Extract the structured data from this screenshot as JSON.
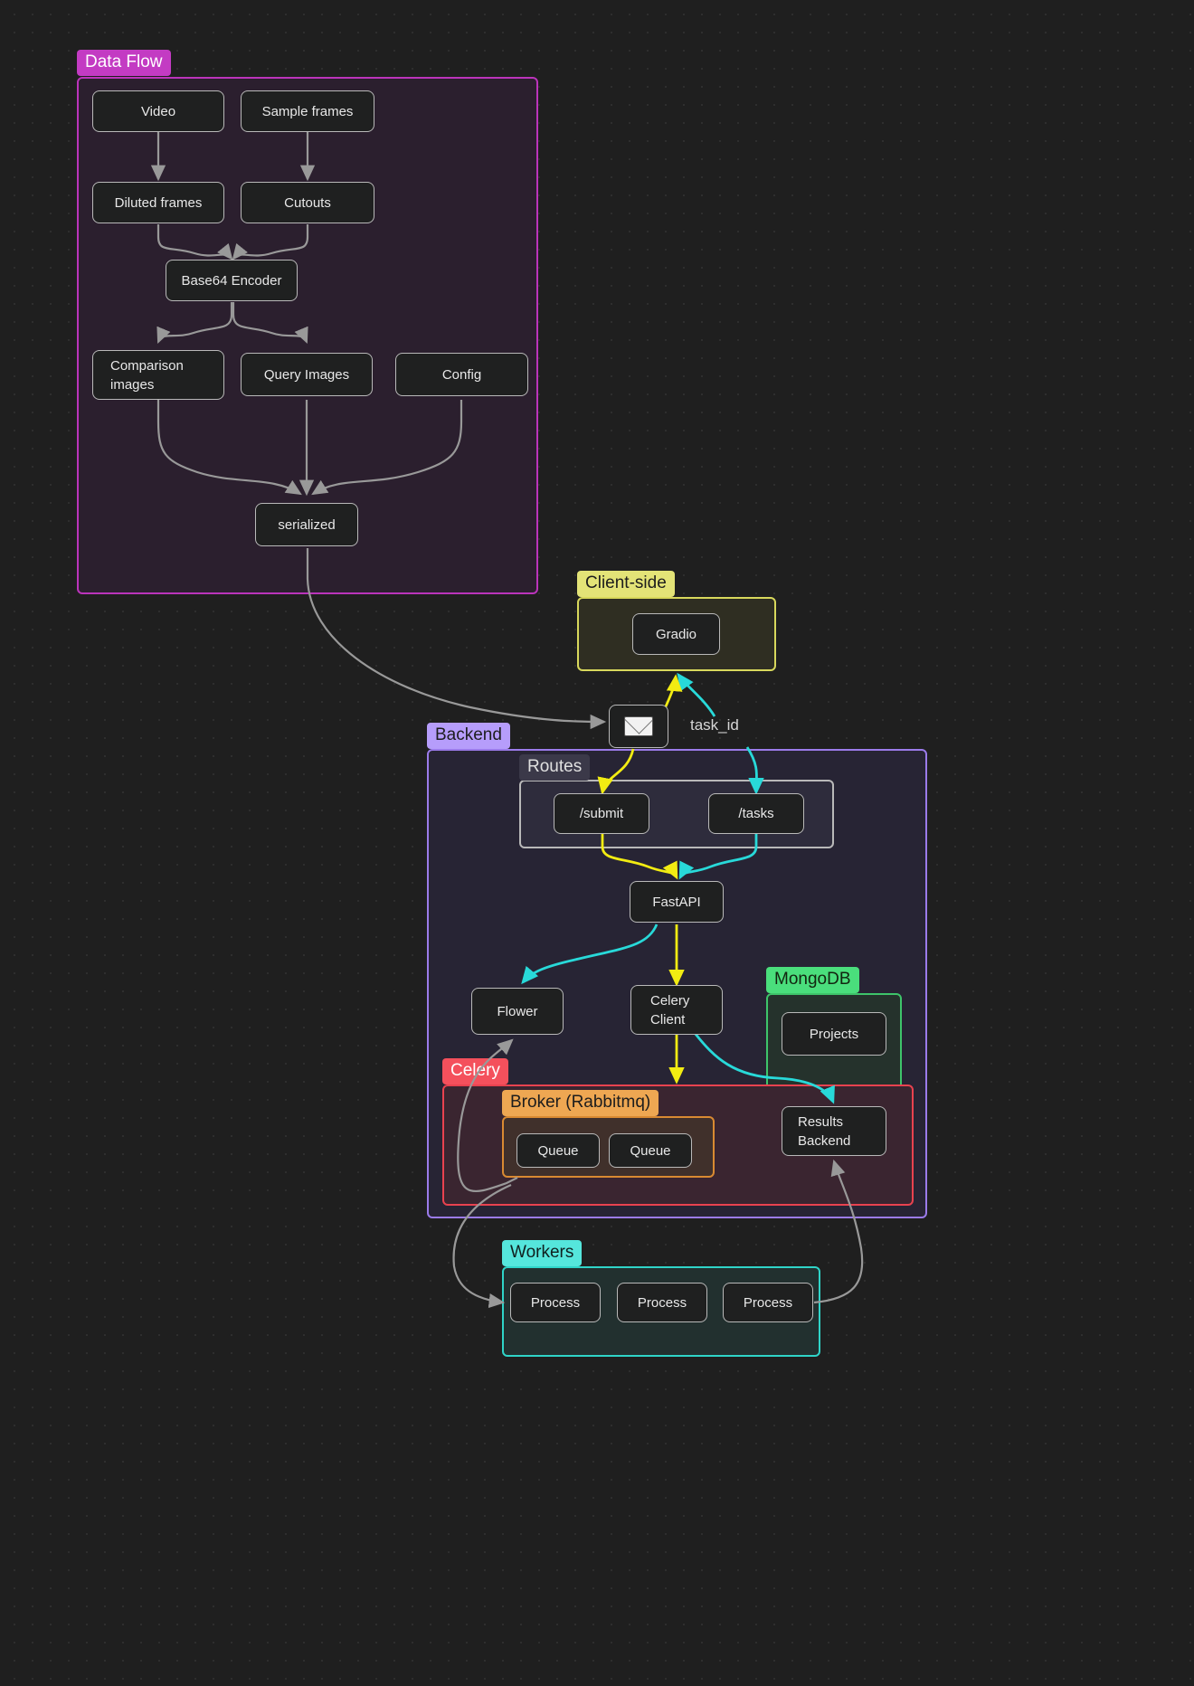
{
  "diagram": {
    "title": "Data Flow / Backend architecture diagram",
    "background": "#1f1f1f"
  },
  "clusters": [
    {
      "id": "data-flow",
      "label": "Data Flow",
      "border_color": "#bb34bb",
      "fill_color": "#2b1f2e",
      "label_bg": "#c33bc3",
      "label_color": "#ffffff"
    },
    {
      "id": "client-side",
      "label": "Client-side",
      "border_color": "#d8d85c",
      "fill_color": "#2f2e22",
      "label_bg": "#e3e377",
      "label_color": "#1d1d1d"
    },
    {
      "id": "backend",
      "label": "Backend",
      "border_color": "#9b7bea",
      "fill_color": "#272434",
      "label_bg": "#b69dfb",
      "label_color": "#1d1d1d"
    },
    {
      "id": "routes",
      "label": "Routes",
      "border_color": "#b9b9b9",
      "fill_color": "#2e2c3c",
      "label_bg": "#3b3949",
      "label_color": "#e0e0e0"
    },
    {
      "id": "mongodb",
      "label": "MongoDB",
      "border_color": "#3ec46a",
      "fill_color": "#25322c",
      "label_bg": "#4ade7c",
      "label_color": "#12240f"
    },
    {
      "id": "celery",
      "label": "Celery",
      "border_color": "#e8424f",
      "fill_color": "#3a2530",
      "label_bg": "#f4505c",
      "label_color": "#ffffff"
    },
    {
      "id": "broker",
      "label": "Broker (Rabbitmq)",
      "border_color": "#d98a32",
      "fill_color": "#40302b",
      "label_bg": "#eda council",
      "label_bg_hex": "#eea752",
      "label_color": "#1d1d1d"
    },
    {
      "id": "workers",
      "label": "Workers",
      "border_color": "#2fd4c8",
      "fill_color": "#22302f",
      "label_bg": "#55e6dc",
      "label_color": "#10201f"
    }
  ],
  "nodes": {
    "video": "Video",
    "sample_frames": "Sample frames",
    "diluted_frames": "Diluted frames",
    "cutouts": "Cutouts",
    "base64_encoder": "Base64 Encoder",
    "comparison_images_line1": "Comparison",
    "comparison_images_line2": "images",
    "query_images": "Query Images",
    "config": "Config",
    "serialized": "serialized",
    "gradio": "Gradio",
    "request": "envelope-icon",
    "submit_route": "/submit",
    "tasks_route": "/tasks",
    "fastapi": "FastAPI",
    "flower": "Flower",
    "celery_client_line1": "Celery",
    "celery_client_line2": "Client",
    "projects": "Projects",
    "results_backend_line1": "Results",
    "results_backend_line2": "Backend",
    "queue_1": "Queue",
    "queue_2": "Queue",
    "process_1": "Process",
    "process_2": "Process",
    "process_3": "Process"
  },
  "edge_labels": {
    "task_id": "task_id"
  },
  "edge_colors": {
    "default": "#999999",
    "request": "#f2ec12",
    "response": "#28d9d9"
  }
}
